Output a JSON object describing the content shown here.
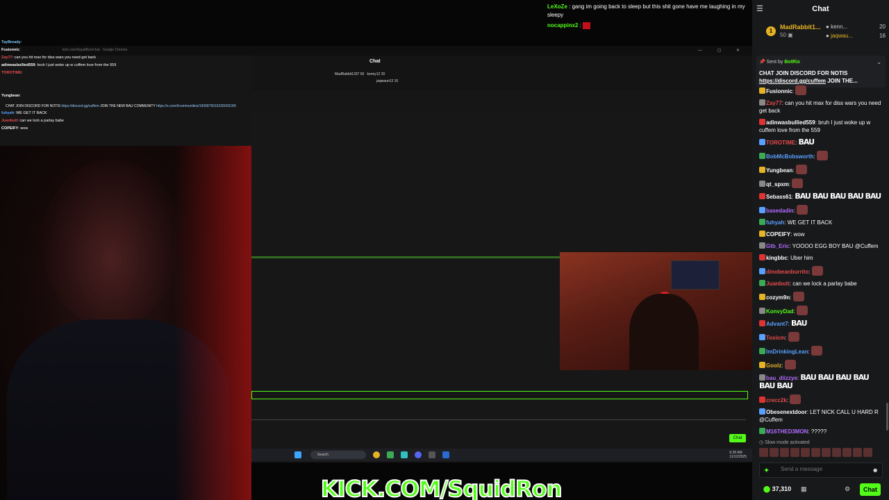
{
  "stream": {
    "top_chat": [
      {
        "user": "LeXoZe",
        "text": ": gang im going back to sleep but this shit gone have me laughing in my sleepy"
      },
      {
        "user": "nocappinx2",
        "text": ":"
      }
    ],
    "desktop": {
      "window_title": "kick.com/SquidRon/chat - Google Chrome",
      "chat_title": "Chat",
      "mini_leaderboard": {
        "first": "MadRabbit1337",
        "first_count": "50",
        "second": "kenny12",
        "second_count": "20",
        "third": "jaqwaun13",
        "third_count": "16"
      },
      "pinned_text": "CHAT JOIN DISCORD FOR NOTIS",
      "pinned_link": "https://discord.gg/cuffem",
      "pinned_more": "JOIN THE NEW BAU COMMUNITY",
      "pinned_link2": "https://x.com/i/communities/1906876516235002189",
      "chat_button": "Chat",
      "taskbar_search": "Search",
      "tray_time": "6:28 AM",
      "tray_date": "11/12/2025"
    },
    "overlay_chat": [
      {
        "user": "TayBready",
        "text": ":"
      },
      {
        "user": "Fusionnic",
        "text": ":"
      },
      {
        "user": "Zay77",
        "text": ": can you hit max for diss wars you need get back"
      },
      {
        "user": "adinwasbullied559",
        "text": ": bruh I just woke up w cuffem love from the 559"
      },
      {
        "user": "TOROTIME",
        "text": ":"
      },
      {
        "user": "Yungbean",
        "text": ":"
      },
      {
        "user": "fuhyah",
        "text": ": WE GET IT BACK"
      },
      {
        "user": "Juanbutt",
        "text": ": can we lock a parlay babe"
      },
      {
        "user": "COPEIFY",
        "text": ": wow"
      }
    ],
    "banner": "KICK.COM/SquidRon"
  },
  "sidebar": {
    "title": "Chat",
    "leaderboard": [
      {
        "rank": "1",
        "name": "MadRabbit1...",
        "count": "50"
      },
      {
        "name": "kenn...",
        "count": "20"
      },
      {
        "name": "jaqwau...",
        "count": "16"
      }
    ],
    "pinned": {
      "sent_by_label": "Sent by",
      "sender": "BotRix",
      "text": "CHAT JOIN DISCORD FOR NOTIS",
      "link": "https://discord.gg/cuffem",
      "more": "JOIN THE..."
    },
    "messages": [
      {
        "user": "Fusionnic",
        "color": "#ffffff",
        "text": ""
      },
      {
        "user": "Zay77",
        "color": "#e84b4b",
        "text": "can you hit max for diss wars you need get back"
      },
      {
        "user": "adinwasbullied559",
        "color": "#ffffff",
        "text": "bruh I just woke up w cuffem love from the 559"
      },
      {
        "user": "TOROTIME",
        "color": "#e84b4b",
        "text": "BAU"
      },
      {
        "user": "BobMcBobsworth",
        "color": "#5aa0ff",
        "text": ""
      },
      {
        "user": "Yungbean",
        "color": "#ffffff",
        "text": ""
      },
      {
        "user": "qt_spxm",
        "color": "#ffffff",
        "text": ""
      },
      {
        "user": "Sebass61",
        "color": "#ffffff",
        "text": "BAU BAU BAU BAU BAU"
      },
      {
        "user": "basedadin",
        "color": "#b26cff",
        "text": ""
      },
      {
        "user": "fuhyah",
        "color": "#5aa0ff",
        "text": "WE GET IT BACK"
      },
      {
        "user": "COPEIFY",
        "color": "#ffffff",
        "text": "wow"
      },
      {
        "user": "Gtb_Eric",
        "color": "#b26cff",
        "text": "YOOOO EGG BOY BAU @Cuffem"
      },
      {
        "user": "kingbbc",
        "color": "#ffffff",
        "text": "Uber him"
      },
      {
        "user": "dinobeanburrito",
        "color": "#e84b4b",
        "text": ""
      },
      {
        "user": "Juanbutt",
        "color": "#e84b4b",
        "text": "can we lock a parlay babe"
      },
      {
        "user": "cozym9n",
        "color": "#ffffff",
        "text": ""
      },
      {
        "user": "KonvyDad",
        "color": "#53fc18",
        "text": ""
      },
      {
        "user": "Advant7",
        "color": "#5aa0ff",
        "text": "BAU"
      },
      {
        "user": "Toxicm",
        "color": "#e84b4b",
        "text": ""
      },
      {
        "user": "ImDrinkingLean",
        "color": "#5aa0ff",
        "text": ""
      },
      {
        "user": "Goolz",
        "color": "#e6b325",
        "text": ""
      },
      {
        "user": "bau_diizzye",
        "color": "#b26cff",
        "text": "BAU BAU BAU BAU BAU BAU"
      },
      {
        "user": "crecc2k",
        "color": "#e84b4b",
        "text": ""
      },
      {
        "user": "Obesenextdoor",
        "color": "#ffffff",
        "text": "LET NICK CALL U HARD R @Cuffem"
      },
      {
        "user": "M16THED3MON",
        "color": "#b26cff",
        "text": "?????"
      }
    ],
    "slow_mode": "Slow mode activated",
    "input_placeholder": "Send a message",
    "viewers": "37,310",
    "chat_button": "Chat",
    "colors": {
      "accent": "#53fc18",
      "background": "#18191b"
    }
  }
}
